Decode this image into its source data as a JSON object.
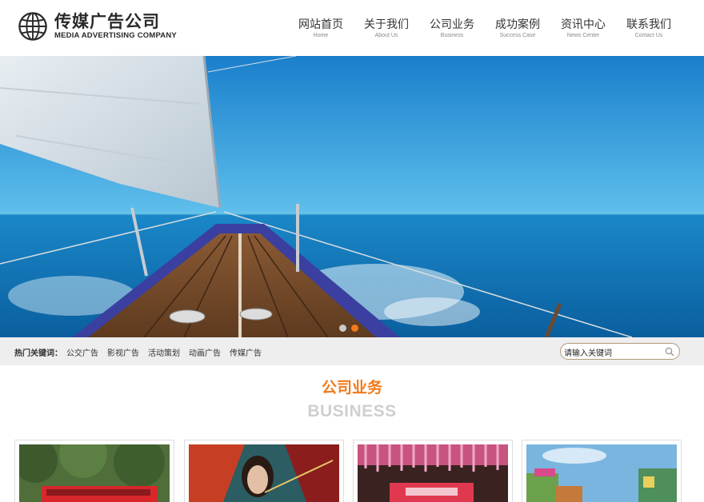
{
  "header": {
    "logo_cn": "传媒广告公司",
    "logo_en": "MEDIA ADVERTISING COMPANY",
    "nav": [
      {
        "cn": "网站首页",
        "en": "Home"
      },
      {
        "cn": "关于我们",
        "en": "About Us"
      },
      {
        "cn": "公司业务",
        "en": "Business"
      },
      {
        "cn": "成功案例",
        "en": "Success Case"
      },
      {
        "cn": "资讯中心",
        "en": "News Center"
      },
      {
        "cn": "联系我们",
        "en": "Contact Us"
      }
    ]
  },
  "banner": {
    "slides": 2,
    "active_slide": 2
  },
  "hotbar": {
    "label": "热门关键词：",
    "links": [
      "公交广告",
      "影视广告",
      "活动策划",
      "动画广告",
      "传媒广告"
    ],
    "search_value": "请输入关键词"
  },
  "section": {
    "title": "公司业务",
    "subtitle": "BUSINESS"
  },
  "colors": {
    "accent": "#f07a1a",
    "subtitle": "#cfcfcf",
    "bar_bg": "#eeeeee"
  },
  "icons": {
    "logo": "globe-icon",
    "search": "magnifier-icon"
  }
}
